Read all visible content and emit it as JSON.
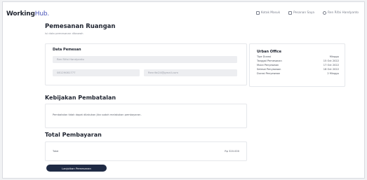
{
  "header": {
    "logo_part1": "Working",
    "logo_part2": "Hub.",
    "nav": {
      "inbox": "Kotak Masuk",
      "bookings": "Pesanan Saya",
      "user": "Ren Rifai Handyanto"
    }
  },
  "page": {
    "title": "Pemesanan Ruangan",
    "subtitle": "isi data pemesanan dibawah"
  },
  "booker": {
    "heading": "Data Pemesan",
    "name": "Ren Rifai Handyanto",
    "phone": "08129081777",
    "email": "Renrifai24@gmail.com"
  },
  "office": {
    "name": "Urban Office",
    "rows": [
      {
        "label": "Tipe Durasi",
        "value": "Minggu"
      },
      {
        "label": "Tanggal Pemesanan",
        "value": "15 Oct 2022"
      },
      {
        "label": "Mulai Penyewaan",
        "value": "17 Oct 2022"
      },
      {
        "label": "Selesai Penyewaan",
        "value": "18 Oct 2022"
      },
      {
        "label": "Durasi Penyewaan",
        "value": "2 Minggu"
      }
    ]
  },
  "policy": {
    "title": "Kebijakan Pembatalan",
    "text": "Pembatalan tidak dapat dilakukan jika sudah melakukan pembayaran."
  },
  "payment": {
    "title": "Total Pembayaran",
    "total_label": "Total",
    "total_value": "Rp 320.000"
  },
  "actions": {
    "continue": "Lanjutkan Pemesanan"
  }
}
